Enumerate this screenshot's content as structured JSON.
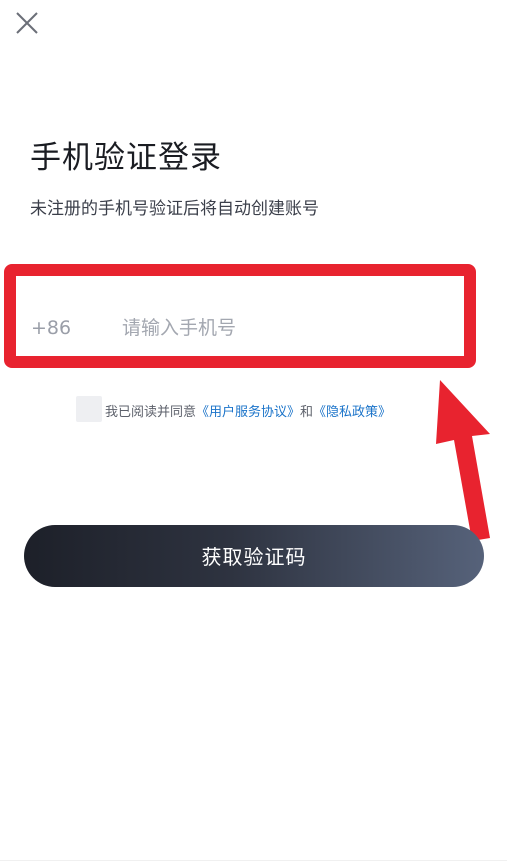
{
  "header": {
    "close_icon": "close-icon"
  },
  "main": {
    "title": "手机验证登录",
    "subtitle": "未注册的手机号验证后将自动创建账号"
  },
  "phone": {
    "country_code": "+86",
    "placeholder": "请输入手机号",
    "value": ""
  },
  "agreement": {
    "prefix": "我已阅读并同意",
    "user_agreement": "《用户服务协议》",
    "and": "和",
    "privacy_policy": "《隐私政策》",
    "checked": false
  },
  "actions": {
    "get_code_label": "获取验证码"
  },
  "colors": {
    "highlight": "#e8232f",
    "link": "#1a73c9",
    "button_start": "#1d2029",
    "button_end": "#56627a"
  }
}
